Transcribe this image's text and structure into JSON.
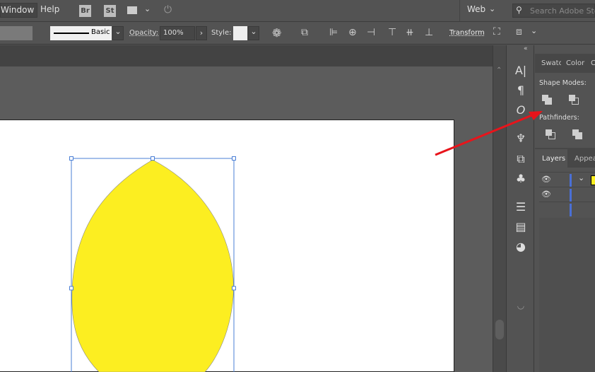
{
  "menubar": {
    "items": [
      "Window",
      "Help"
    ],
    "bridge": "Br",
    "stock": "St",
    "workspace": "Web",
    "search_placeholder": "Search Adobe Stock"
  },
  "control": {
    "stroke_style": "Basic",
    "opacity_label": "Opacity:",
    "opacity_value": "100%",
    "style_label": "Style:",
    "transform_label": "Transform"
  },
  "panel": {
    "tabs": [
      "Swatches",
      "Color",
      "C"
    ],
    "shape_modes": "Shape Modes:",
    "pathfinders": "Pathfinders:",
    "layers_tabs": [
      "Layers",
      "Appearance"
    ]
  },
  "colors": {
    "shape_fill": "#fcee21",
    "selection": "#4a7fd6",
    "arrow": "#e8141b"
  }
}
